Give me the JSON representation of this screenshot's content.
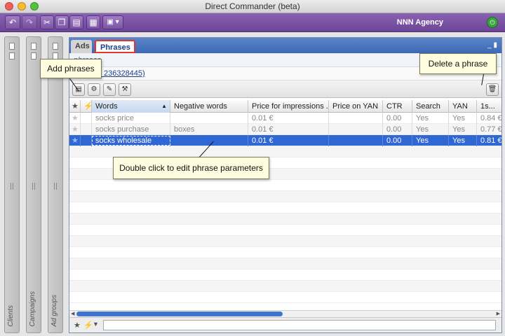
{
  "window": {
    "title": "Direct Commander (beta)"
  },
  "toolbar": {
    "buttons": [
      {
        "name": "undo-button",
        "glyph": "↶"
      },
      {
        "name": "redo-button",
        "glyph": "↷"
      },
      {
        "name": "cut-button",
        "glyph": "✂"
      },
      {
        "name": "copy-button",
        "glyph": "❐"
      },
      {
        "name": "paste-button",
        "glyph": "▤"
      },
      {
        "name": "table-button",
        "glyph": "▦"
      },
      {
        "name": "view-menu-button",
        "glyph": "▣ ▾"
      }
    ],
    "agency": "NNN Agency",
    "exit_glyph": "⏻"
  },
  "sidebars": [
    {
      "label": "Clients"
    },
    {
      "label": "Campaigns"
    },
    {
      "label": "Ad groups"
    }
  ],
  "tabs": {
    "ads": "Ads",
    "phrases": "Phrases"
  },
  "panel_controls": "_ ▮",
  "breadcrumb": "phrases",
  "campaign_link": "erve (№ 236328445)",
  "actions": {
    "add_glyph": "▤",
    "a2": "⚙",
    "a3": "✎",
    "a4": "⚒",
    "delete_glyph": "🗑"
  },
  "table": {
    "columns": [
      {
        "key": "star",
        "label": "★"
      },
      {
        "key": "flag",
        "label": "⚡"
      },
      {
        "key": "words",
        "label": "Words"
      },
      {
        "key": "negative",
        "label": "Negative words"
      },
      {
        "key": "price",
        "label": "Price for impressions ..."
      },
      {
        "key": "price_yan",
        "label": "Price on YAN"
      },
      {
        "key": "ctr",
        "label": "CTR"
      },
      {
        "key": "search",
        "label": "Search"
      },
      {
        "key": "yan",
        "label": "YAN"
      },
      {
        "key": "first",
        "label": "1s..."
      }
    ],
    "sort_glyph": "▲",
    "rows": [
      {
        "star": "★",
        "words": "socks price",
        "negative": "",
        "price": "0.01 €",
        "price_yan": "",
        "ctr": "0.00",
        "search": "Yes",
        "yan": "Yes",
        "first": "0.84 €"
      },
      {
        "star": "★",
        "words": "socks purchase",
        "negative": "boxes",
        "price": "0.01 €",
        "price_yan": "",
        "ctr": "0.00",
        "search": "Yes",
        "yan": "Yes",
        "first": "0.77 €"
      },
      {
        "star": "★",
        "words": "socks wholesale",
        "negative": "",
        "price": "0.01 €",
        "price_yan": "",
        "ctr": "0.00",
        "search": "Yes",
        "yan": "Yes",
        "first": "0.81 €"
      }
    ]
  },
  "filter_bar": {
    "star": "★",
    "flag": "⚡",
    "funnel": "▼"
  },
  "callouts": {
    "add": "Add phrases",
    "delete": "Delete a phrase",
    "edit": "Double click to edit phrase parameters"
  }
}
